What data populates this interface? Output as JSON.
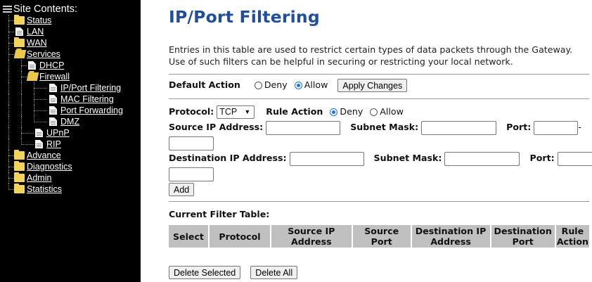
{
  "sidebar": {
    "root_label": "Site Contents:",
    "items": [
      {
        "label": "Status",
        "icon": "folder-icon"
      },
      {
        "label": "LAN",
        "icon": "document-icon"
      },
      {
        "label": "WAN",
        "icon": "folder-icon"
      },
      {
        "label": "Services",
        "icon": "folder-open-icon"
      },
      {
        "label": "DHCP",
        "icon": "document-icon"
      },
      {
        "label": "Firewall",
        "icon": "folder-open-icon"
      },
      {
        "label": "IP/Port Filtering",
        "icon": "document-icon"
      },
      {
        "label": "MAC Filtering",
        "icon": "document-icon"
      },
      {
        "label": "Port Forwarding",
        "icon": "document-icon"
      },
      {
        "label": "DMZ",
        "icon": "document-icon"
      },
      {
        "label": "UPnP",
        "icon": "document-icon"
      },
      {
        "label": "RIP",
        "icon": "document-icon"
      },
      {
        "label": "Advance",
        "icon": "folder-icon"
      },
      {
        "label": "Diagnostics",
        "icon": "folder-icon"
      },
      {
        "label": "Admin",
        "icon": "folder-icon"
      },
      {
        "label": "Statistics",
        "icon": "folder-icon"
      }
    ]
  },
  "page": {
    "title": "IP/Port Filtering",
    "intro": "Entries in this table are used to restrict certain types of data packets through the Gateway. Use of such filters can be helpful in securing or restricting your local network."
  },
  "default_action": {
    "label": "Default Action",
    "deny_label": "Deny",
    "allow_label": "Allow",
    "selected": "Allow",
    "apply_label": "Apply Changes"
  },
  "rule": {
    "protocol_label": "Protocol:",
    "protocol_value": "TCP",
    "rule_action_label": "Rule Action",
    "deny_label": "Deny",
    "allow_label": "Allow",
    "selected": "Deny",
    "source_ip_label": "Source IP Address:",
    "source_mask_label": "Subnet Mask:",
    "source_port_label": "Port:",
    "dest_ip_label": "Destination IP Address:",
    "dest_mask_label": "Subnet Mask:",
    "dest_port_label": "Port:",
    "range_dash": "-",
    "add_label": "Add"
  },
  "filter_table": {
    "title": "Current Filter Table:",
    "columns": [
      "Select",
      "Protocol",
      "Source IP Address",
      "Source Port",
      "Destination IP Address",
      "Destination Port",
      "Rule Action"
    ]
  },
  "actions": {
    "delete_selected": "Delete Selected",
    "delete_all": "Delete All"
  },
  "colors": {
    "title": "#1f4e9c",
    "sidebar_bg": "#000000",
    "table_header_bg": "#c0c0c0",
    "radio_selected": "#1a73e8"
  }
}
